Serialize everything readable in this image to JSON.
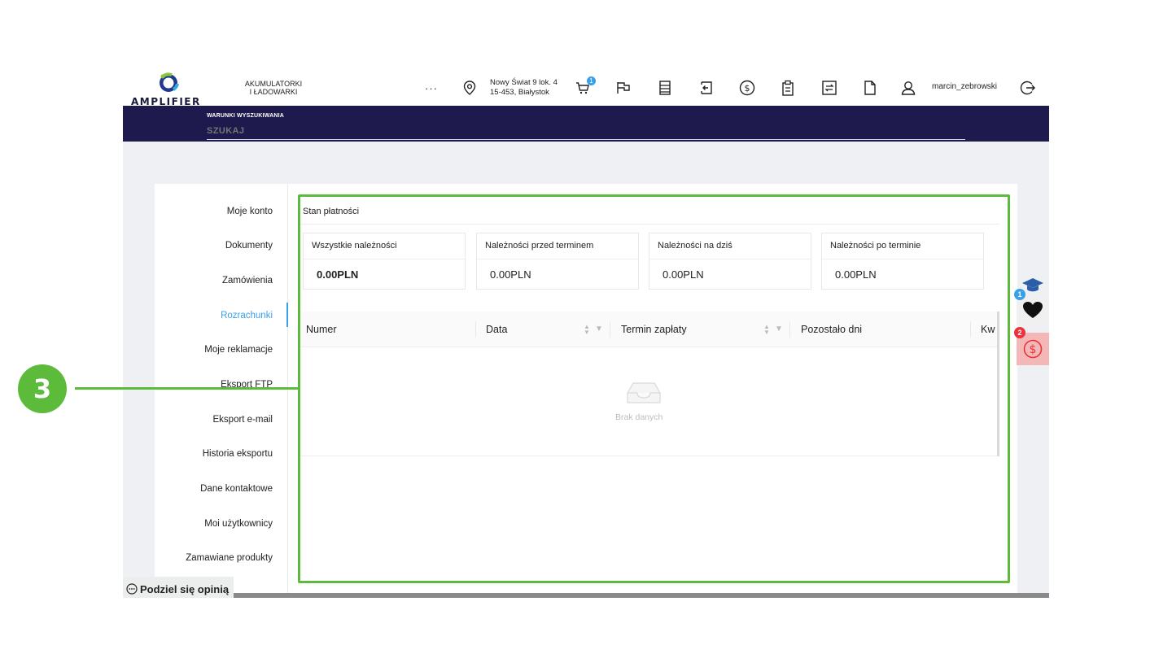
{
  "header": {
    "logo_text": "AMPLIFIER",
    "category": "AKUMULATORKI I ŁADOWARKI",
    "more_label": "···",
    "address_line1": "Nowy Świat 9 lok. 4",
    "address_line2": "15-453, Białystok",
    "cart_count": "1",
    "username": "marcin_zebrowski"
  },
  "search": {
    "label": "WARUNKI WYSZUKIWANIA",
    "placeholder": "SZUKAJ"
  },
  "sidebar": {
    "items": [
      {
        "label": "Moje konto"
      },
      {
        "label": "Dokumenty"
      },
      {
        "label": "Zamówienia"
      },
      {
        "label": "Rozrachunki"
      },
      {
        "label": "Moje reklamacje"
      },
      {
        "label": "Eksport FTP"
      },
      {
        "label": "Eksport e-mail"
      },
      {
        "label": "Historia eksportu"
      },
      {
        "label": "Dane kontaktowe"
      },
      {
        "label": "Moi użytkownicy"
      },
      {
        "label": "Zamawiane produkty"
      }
    ],
    "active_index": 3
  },
  "payments": {
    "title": "Stan płatności",
    "stats": [
      {
        "label": "Wszystkie należności",
        "value": "0.00PLN"
      },
      {
        "label": "Należności przed terminem",
        "value": "0.00PLN"
      },
      {
        "label": "Należności na dziś",
        "value": "0.00PLN"
      },
      {
        "label": "Należności po terminie",
        "value": "0.00PLN"
      }
    ]
  },
  "table": {
    "columns": [
      "Numer",
      "Data",
      "Termin zapłaty",
      "Pozostało dni",
      "Kw"
    ],
    "empty_text": "Brak danych"
  },
  "widgets": {
    "heart_badge": "1",
    "dollar_badge": "2",
    "accent_blue": "#3aa0e8",
    "alert_red": "#e8343a"
  },
  "annotation": {
    "callout_number": "3",
    "highlight_color": "#5dbb3c"
  },
  "feedback": {
    "label": "Podziel się opinią"
  },
  "colors": {
    "navy": "#1f1a4d",
    "active": "#3aa0e8"
  }
}
